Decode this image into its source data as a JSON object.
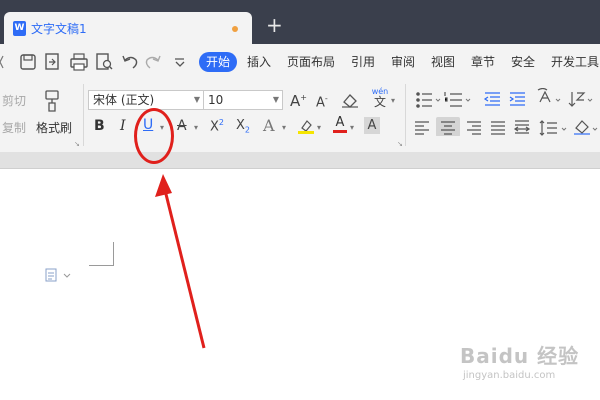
{
  "tab": {
    "title": "文字文稿1",
    "icon": "W",
    "new_tab": "+"
  },
  "quick_access": {
    "more": "▾"
  },
  "menu": {
    "items": [
      "开始",
      "插入",
      "页面布局",
      "引用",
      "审阅",
      "视图",
      "章节",
      "安全",
      "开发工具"
    ],
    "active": "开始"
  },
  "ribbon": {
    "cut": "剪切",
    "copy": "复制",
    "format_painter": "格式刷",
    "font_name": "宋体 (正文)",
    "font_size": "10",
    "bold": "B",
    "italic": "I",
    "underline": "U",
    "strike": "A",
    "superscript": "X",
    "sup_mark": "2",
    "subscript": "X",
    "sub_mark": "2",
    "grow_font": "A",
    "shrink_font": "A",
    "pinyin": "wén",
    "pinyin_char": "文",
    "text_effect": "A",
    "font_color": "A",
    "char_shade": "A"
  },
  "watermark": {
    "brand": "Baidu 经验",
    "url": "jingyan.baidu.com"
  },
  "colors": {
    "accent": "#2e6cf6",
    "annotation": "#e0201c",
    "titlebar": "#3a3f4c"
  }
}
